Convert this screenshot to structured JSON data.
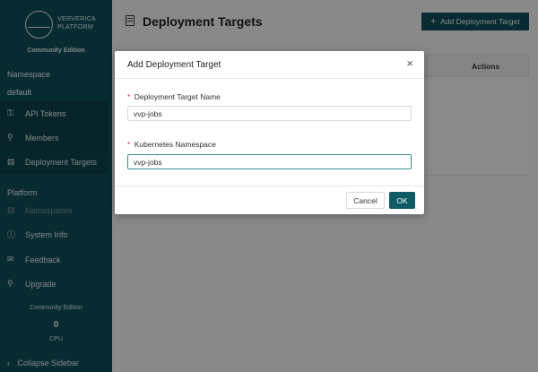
{
  "sidebar": {
    "logo_line1": "VERVERICA",
    "logo_line2": "PLATFORM",
    "edition": "Community Edition",
    "namespace_label": "Namespace",
    "namespace_value": "default",
    "ns_items": [
      {
        "label": "API Tokens",
        "icon": "key-icon"
      },
      {
        "label": "Members",
        "icon": "members-icon"
      },
      {
        "label": "Deployment Targets",
        "icon": "deployment-targets-icon"
      }
    ],
    "platform_label": "Platform",
    "platform_items": [
      {
        "label": "Namespaces",
        "icon": "namespaces-icon"
      },
      {
        "label": "System Info",
        "icon": "info-icon"
      },
      {
        "label": "Feedback",
        "icon": "feedback-icon"
      },
      {
        "label": "Upgrade",
        "icon": "upgrade-icon"
      }
    ],
    "usage_label": "Community Edition",
    "usage_value": "0",
    "usage_unit": "CPU",
    "collapse_label": "Collapse Sidebar"
  },
  "page": {
    "title": "Deployment Targets",
    "add_button": "Add Deployment Target",
    "table_actions_header": "Actions"
  },
  "modal": {
    "title": "Add Deployment Target",
    "close_glyph": "×",
    "field1_label": "Deployment Target Name",
    "field1_value": "vvp-jobs",
    "field2_label": "Kubernetes Namespace",
    "field2_value": "vvp-jobs",
    "required_mark": "*",
    "cancel_label": "Cancel",
    "ok_label": "OK"
  },
  "colors": {
    "sidebar_bg": "#0e4b56",
    "primary": "#0e5b66",
    "focus_border": "#3b8c91",
    "required": "#d9363e"
  }
}
